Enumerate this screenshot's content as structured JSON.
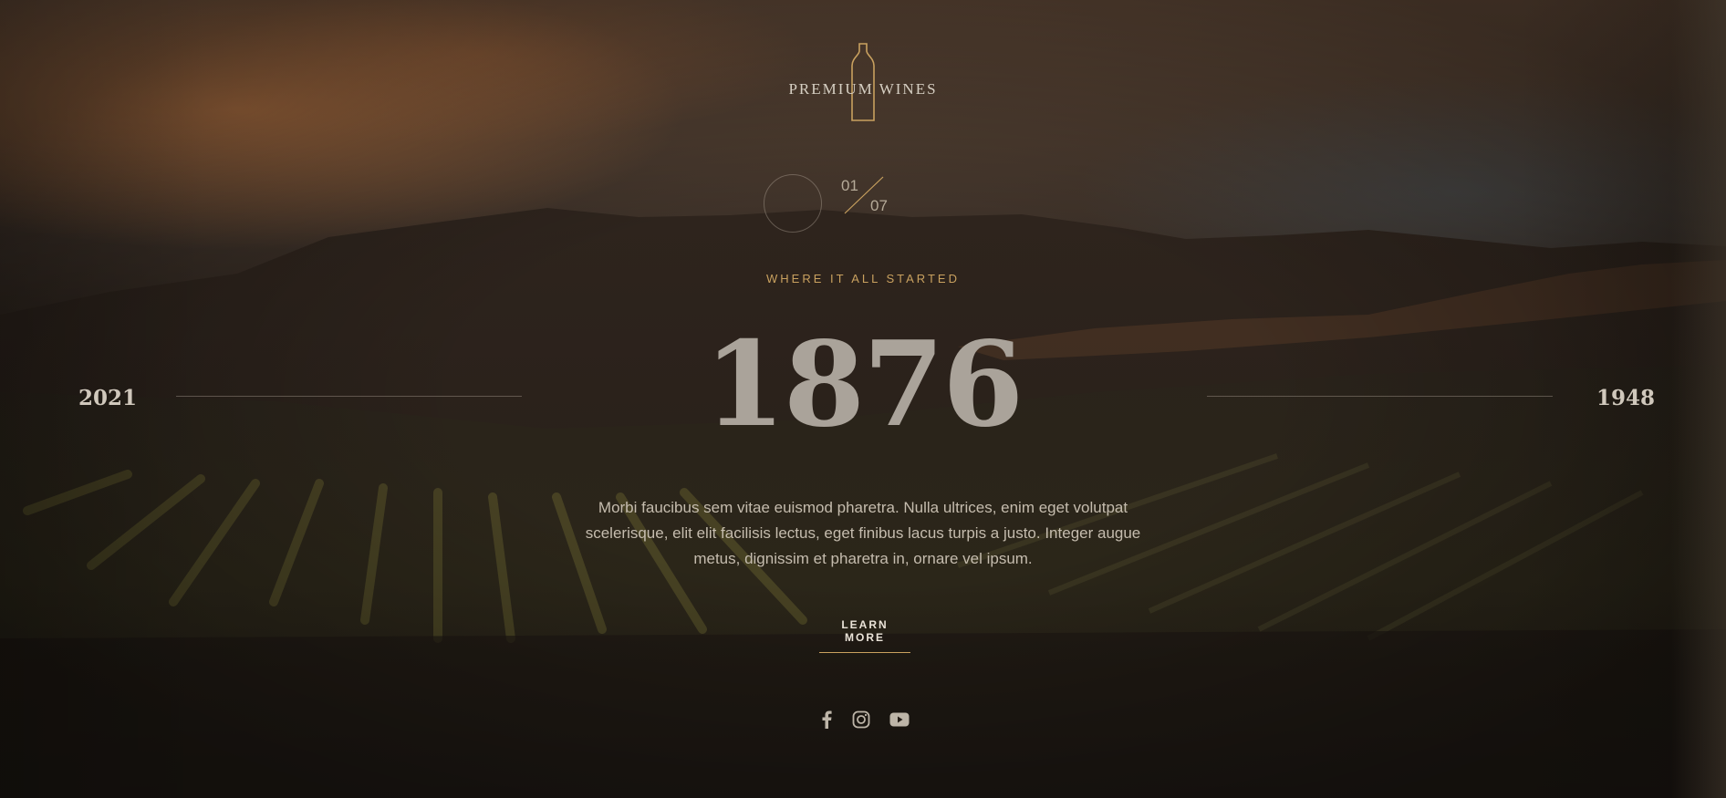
{
  "brand": {
    "name": "PREMIUM WINES",
    "accent_color": "#c9a15f"
  },
  "slider": {
    "current": "01",
    "total": "07"
  },
  "hero": {
    "eyebrow": "WHERE IT ALL STARTED",
    "year": "1876",
    "prev_year": "2021",
    "next_year": "1948",
    "description": "Morbi faucibus sem vitae euismod pharetra. Nulla ultrices, enim eget volutpat scelerisque, elit elit facilisis lectus, eget finibus lacus turpis a justo. Integer augue metus, dignissim et pharetra in, ornare vel ipsum.",
    "cta_label": "LEARN MORE"
  },
  "social": {
    "icons": [
      "facebook-icon",
      "instagram-icon",
      "youtube-icon"
    ]
  }
}
